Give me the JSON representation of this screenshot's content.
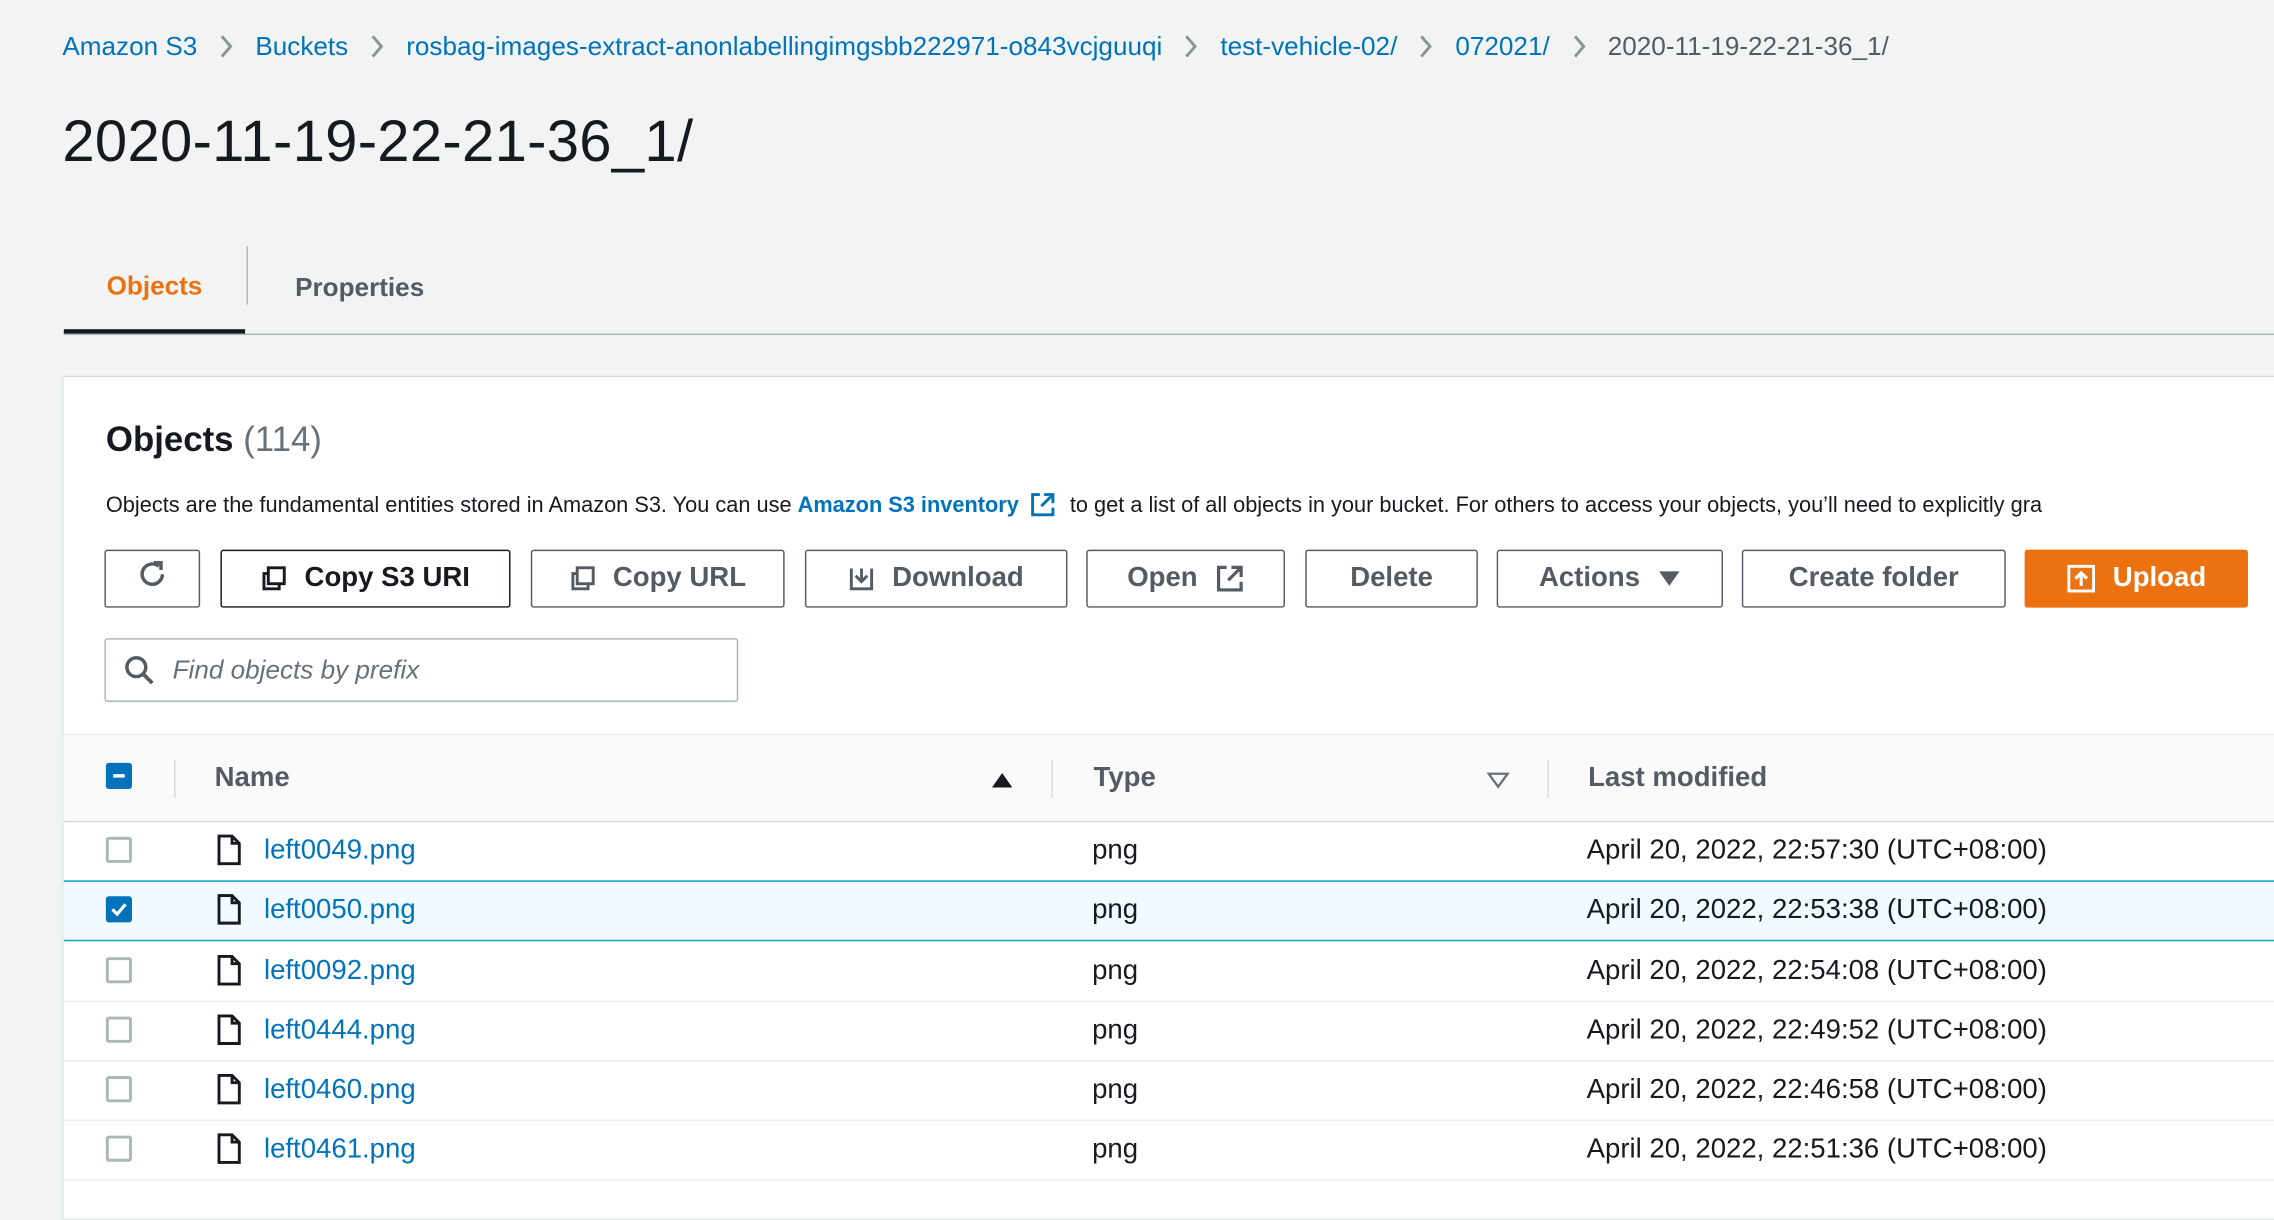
{
  "breadcrumbs": [
    {
      "label": "Amazon S3"
    },
    {
      "label": "Buckets"
    },
    {
      "label": "rosbag-images-extract-anonlabellingimgsbb222971-o843vcjguuqi"
    },
    {
      "label": "test-vehicle-02/"
    },
    {
      "label": "072021/"
    },
    {
      "label": "2020-11-19-22-21-36_1/"
    }
  ],
  "page": {
    "title": "2020-11-19-22-21-36_1/"
  },
  "tabs": [
    {
      "label": "Objects",
      "active": true
    },
    {
      "label": "Properties",
      "active": false
    }
  ],
  "objects_panel": {
    "title": "Objects",
    "count": "(114)",
    "description_before": "Objects are the fundamental entities stored in Amazon S3. You can use ",
    "description_link": "Amazon S3 inventory",
    "description_after": " to get a list of all objects in your bucket. For others to access your objects, you’ll need to explicitly gra"
  },
  "toolbar": {
    "refresh_icon": "refresh-icon",
    "copy_s3_uri": "Copy S3 URI",
    "copy_url": "Copy URL",
    "download": "Download",
    "open": "Open",
    "delete": "Delete",
    "actions": "Actions",
    "create_folder": "Create folder",
    "upload": "Upload"
  },
  "search": {
    "placeholder": "Find objects by prefix",
    "value": ""
  },
  "table": {
    "columns": {
      "name": "Name",
      "type": "Type",
      "last_modified": "Last modified"
    },
    "header_checkbox_state": "indeterminate",
    "rows": [
      {
        "name": "left0049.png",
        "type": "png",
        "last_modified": "April 20, 2022, 22:57:30 (UTC+08:00)",
        "selected": false
      },
      {
        "name": "left0050.png",
        "type": "png",
        "last_modified": "April 20, 2022, 22:53:38 (UTC+08:00)",
        "selected": true
      },
      {
        "name": "left0092.png",
        "type": "png",
        "last_modified": "April 20, 2022, 22:54:08 (UTC+08:00)",
        "selected": false
      },
      {
        "name": "left0444.png",
        "type": "png",
        "last_modified": "April 20, 2022, 22:49:52 (UTC+08:00)",
        "selected": false
      },
      {
        "name": "left0460.png",
        "type": "png",
        "last_modified": "April 20, 2022, 22:46:58 (UTC+08:00)",
        "selected": false
      },
      {
        "name": "left0461.png",
        "type": "png",
        "last_modified": "April 20, 2022, 22:51:36 (UTC+08:00)",
        "selected": false
      }
    ]
  },
  "colors": {
    "accent": "#ec7211",
    "link": "#0073bb",
    "selected_row": "#f1faff"
  }
}
